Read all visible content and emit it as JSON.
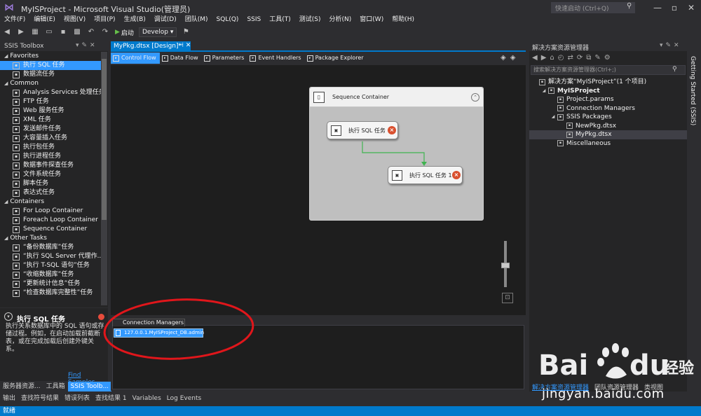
{
  "window": {
    "title": "MyISProject - Microsoft Visual Studio(管理员)",
    "quick_launch": "快速启动 (Ctrl+Q)",
    "controls": [
      "—",
      "▫",
      "✕"
    ]
  },
  "menu": [
    "文件(F)",
    "编辑(E)",
    "视图(V)",
    "项目(P)",
    "生成(B)",
    "调试(D)",
    "团队(M)",
    "SQL(Q)",
    "SSIS",
    "工具(T)",
    "测试(S)",
    "分析(N)",
    "窗口(W)",
    "帮助(H)"
  ],
  "toolbar": {
    "start_label": "启动",
    "config_value": "Develop ▾"
  },
  "toolbox": {
    "title": "SSIS Toolbox",
    "groups": [
      {
        "name": "Favorites",
        "items": [
          "执行 SQL 任务",
          "数据流任务"
        ]
      },
      {
        "name": "Common",
        "items": [
          "Analysis Services 处理任务",
          "FTP 任务",
          "Web 服务任务",
          "XML 任务",
          "发送邮件任务",
          "大容量插入任务",
          "执行包任务",
          "执行进程任务",
          "数据事件探查任务",
          "文件系统任务",
          "脚本任务",
          "表达式任务"
        ]
      },
      {
        "name": "Containers",
        "items": [
          "For Loop Container",
          "Foreach Loop Container",
          "Sequence Container"
        ]
      },
      {
        "name": "Other Tasks",
        "items": [
          "“备份数据库”任务",
          "“执行 SQL Server 代理作...",
          "“执行 T-SQL 语句”任务",
          "“收缩数据库”任务",
          "“更新统计信息”任务",
          "“检查数据库完整性”任务"
        ]
      }
    ],
    "selected": "执行 SQL 任务"
  },
  "description": {
    "title": "执行 SQL 任务",
    "text": "执行关系数据库中的 SQL 语句或存储过程。例如，在启动加载前截断表，或在完成加载后创建外键关系。",
    "link": "Find Samples"
  },
  "left_tabs": [
    "服务器资源...",
    "工具箱",
    "SSIS Toolb..."
  ],
  "document": {
    "tab_label": "MyPkg.dtsx [Design]*",
    "design_tabs": [
      "Control Flow",
      "Data Flow",
      "Parameters",
      "Event Handlers",
      "Package Explorer"
    ],
    "active_tab": "Control Flow",
    "container_title": "Sequence Container",
    "task1": "执行 SQL 任务",
    "task2": "执行 SQL 任务 1"
  },
  "connections": {
    "tab_label": "Connection Managers",
    "items": [
      "127.0.0.1.MyISProject_DB.admin"
    ]
  },
  "solution": {
    "title": "解决方案资源管理器",
    "search_placeholder": "搜索解决方案资源管理器(Ctrl+;)",
    "tree": [
      {
        "label": "解决方案“MyISProject”(1 个项目)",
        "level": 0,
        "expand": ""
      },
      {
        "label": "MyISProject",
        "level": 1,
        "expand": "◢",
        "bold": true
      },
      {
        "label": "Project.params",
        "level": 2,
        "expand": ""
      },
      {
        "label": "Connection Managers",
        "level": 2,
        "expand": ""
      },
      {
        "label": "SSIS Packages",
        "level": 2,
        "expand": "◢"
      },
      {
        "label": "NewPkg.dtsx",
        "level": 3,
        "expand": ""
      },
      {
        "label": "MyPkg.dtsx",
        "level": 3,
        "expand": "",
        "selected": true
      },
      {
        "label": "Miscellaneous",
        "level": 2,
        "expand": ""
      }
    ],
    "bottom_tabs": [
      "解决方案资源管理器",
      "团队资源管理器",
      "类视图"
    ]
  },
  "vertical_tab": "Getting Started (SSIS)",
  "output_tabs": [
    "输出",
    "查找符号结果",
    "错误列表",
    "查找结果 1",
    "Variables",
    "Log Events"
  ],
  "status": "就绪",
  "watermark": {
    "url": "jingyan.baidu.com"
  },
  "colors": {
    "accent": "#007acc",
    "selected": "#3399ff",
    "annotation": "#e0161b"
  }
}
